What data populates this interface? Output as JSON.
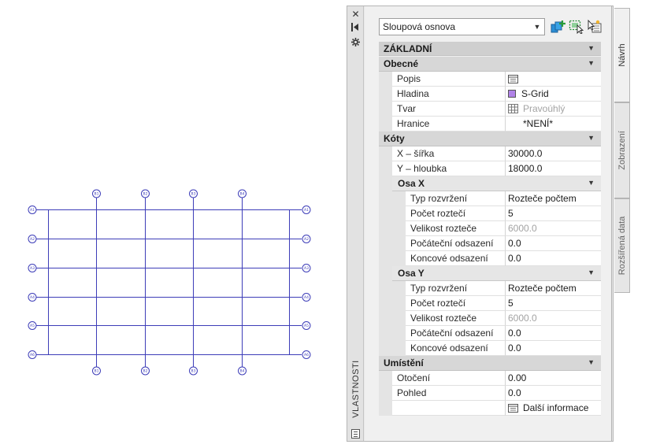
{
  "drawing": {
    "grid_color": "#3d3db8",
    "columns": [
      "B1",
      "B2",
      "B3",
      "B4"
    ],
    "rows": [
      "A1",
      "A2",
      "A3",
      "A4",
      "A5",
      "A6"
    ]
  },
  "palette": {
    "title": "VLASTNOSTI",
    "style_select": {
      "value": "Sloupová osnova"
    },
    "tabs": {
      "design": "Návrh",
      "display": "Zobrazení",
      "extended": "Rozšířená data"
    },
    "sections": {
      "basic": "ZÁKLADNÍ",
      "general": {
        "label": "Obecné",
        "rows": [
          {
            "name": "Popis",
            "value": "",
            "icon": "description-icon"
          },
          {
            "name": "Hladina",
            "value": "S-Grid",
            "color": "#b183e8"
          },
          {
            "name": "Tvar",
            "value": "Pravoúhlý",
            "icon": "grid-shape-icon"
          },
          {
            "name": "Hranice",
            "value": "*NENÍ*"
          }
        ]
      },
      "dimensions": {
        "label": "Kóty",
        "rows": [
          {
            "name": "X – šířka",
            "value": "30000.0"
          },
          {
            "name": "Y – hloubka",
            "value": "18000.0"
          }
        ]
      },
      "axis_x": {
        "label": "Osa X",
        "rows": [
          {
            "name": "Typ rozvržení",
            "value": "Rozteče počtem"
          },
          {
            "name": "Počet roztečí",
            "value": "5"
          },
          {
            "name": "Velikost rozteče",
            "value": "6000.0"
          },
          {
            "name": "Počáteční odsazení",
            "value": "0.0"
          },
          {
            "name": "Koncové odsazení",
            "value": "0.0"
          }
        ]
      },
      "axis_y": {
        "label": "Osa Y",
        "rows": [
          {
            "name": "Typ rozvržení",
            "value": "Rozteče počtem"
          },
          {
            "name": "Počet roztečí",
            "value": "5"
          },
          {
            "name": "Velikost rozteče",
            "value": "6000.0"
          },
          {
            "name": "Počáteční odsazení",
            "value": "0.0"
          },
          {
            "name": "Koncové odsazení",
            "value": "0.0"
          }
        ]
      },
      "location": {
        "label": "Umístění",
        "rows": [
          {
            "name": "Otočení",
            "value": "0.00"
          },
          {
            "name": "Pohled",
            "value": "0.0"
          }
        ],
        "more_info": "Další informace"
      }
    }
  }
}
